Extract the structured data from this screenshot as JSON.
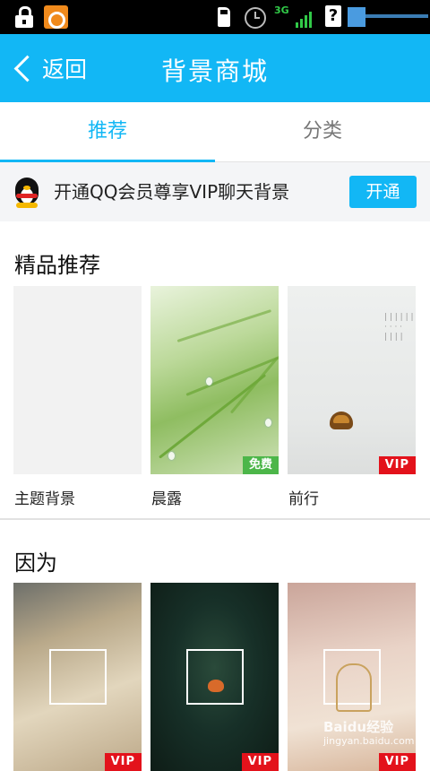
{
  "status_bar": {
    "network": "3G",
    "icons": [
      "lock-icon",
      "app-notification-icon",
      "sd-card-icon",
      "alarm-clock-icon",
      "signal-icon",
      "unknown-status-icon",
      "battery-icon"
    ]
  },
  "header": {
    "back_label": "返回",
    "title": "背景商城",
    "color": "#12b7f5"
  },
  "tabs": [
    {
      "label": "推荐",
      "active": true
    },
    {
      "label": "分类",
      "active": false
    }
  ],
  "vip_banner": {
    "text": "开通QQ会员尊享VIP聊天背景",
    "button_label": "开通"
  },
  "sections": [
    {
      "title": "精品推荐",
      "items": [
        {
          "caption": "主题背景",
          "tag": ""
        },
        {
          "caption": "晨露",
          "tag": "免费"
        },
        {
          "caption": "前行",
          "tag": "VIP"
        }
      ]
    },
    {
      "title": "因为",
      "items": [
        {
          "caption": "",
          "tag": "VIP"
        },
        {
          "caption": "",
          "tag": "VIP"
        },
        {
          "caption": "",
          "tag": "VIP"
        }
      ]
    }
  ],
  "watermark": {
    "brand": "Baidu经验",
    "url": "jingyan.baidu.com"
  },
  "colors": {
    "accent": "#12b7f5",
    "free_tag": "#4cb649",
    "vip_tag": "#e3121b"
  }
}
